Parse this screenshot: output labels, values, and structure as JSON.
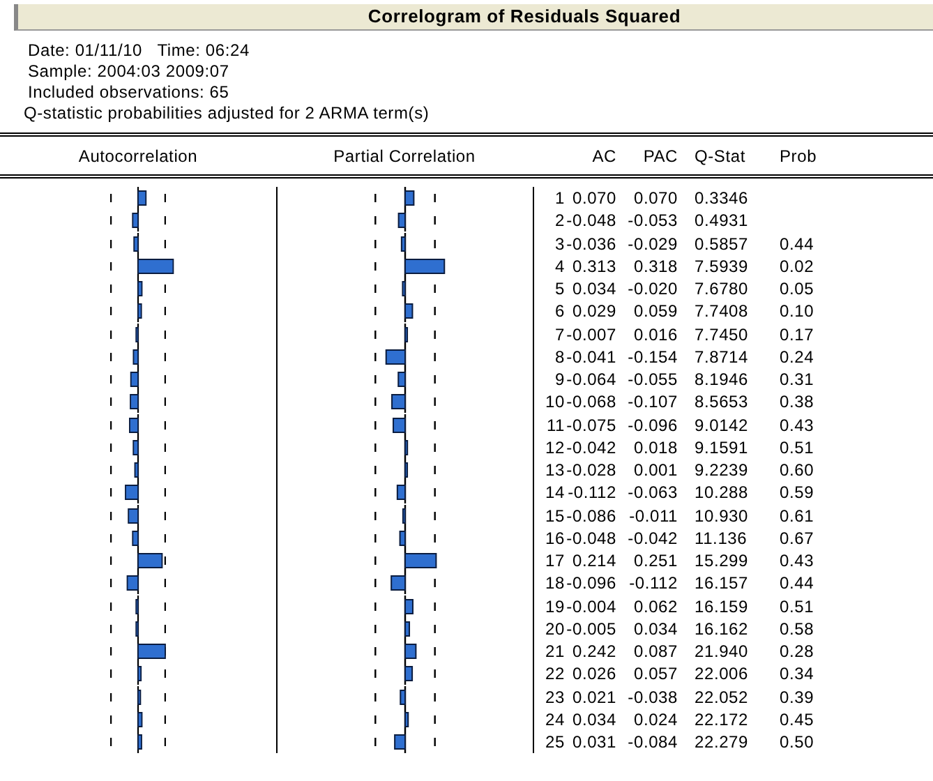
{
  "title": "Correlogram of Residuals Squared",
  "info": [
    "Date: 01/11/10   Time: 06:24",
    "Sample: 2004:03 2009:07",
    "Included observations: 65",
    "Q-statistic probabilities adjusted for 2 ARMA term(s)"
  ],
  "columns": [
    "Autocorrelation",
    "Partial Correlation",
    "AC",
    "PAC",
    "Q-Stat",
    "Prob"
  ],
  "rows": [
    {
      "lag": "1",
      "ac": "0.070",
      "pac": "0.070",
      "q": "0.3346"
    },
    {
      "lag": "2",
      "ac": "-0.048",
      "pac": "-0.053",
      "q": "0.4931"
    },
    {
      "lag": "3",
      "ac": "-0.036",
      "pac": "-0.029",
      "q": "0.5857",
      "prob": "0.44"
    },
    {
      "lag": "4",
      "ac": "0.313",
      "pac": "0.318",
      "q": "7.5939",
      "prob": "0.02"
    },
    {
      "lag": "5",
      "ac": "0.034",
      "pac": "-0.020",
      "q": "7.6780",
      "prob": "0.05"
    },
    {
      "lag": "6",
      "ac": "0.029",
      "pac": "0.059",
      "q": "7.7408",
      "prob": "0.10"
    },
    {
      "lag": "7",
      "ac": "-0.007",
      "pac": "0.016",
      "q": "7.7450",
      "prob": "0.17"
    },
    {
      "lag": "8",
      "ac": "-0.041",
      "pac": "-0.154",
      "q": "7.8714",
      "prob": "0.24"
    },
    {
      "lag": "9",
      "ac": "-0.064",
      "pac": "-0.055",
      "q": "8.1946",
      "prob": "0.31"
    },
    {
      "lag": "10",
      "ac": "-0.068",
      "pac": "-0.107",
      "q": "8.5653",
      "prob": "0.38"
    },
    {
      "lag": "11",
      "ac": "-0.075",
      "pac": "-0.096",
      "q": "9.0142",
      "prob": "0.43"
    },
    {
      "lag": "12",
      "ac": "-0.042",
      "pac": "0.018",
      "q": "9.1591",
      "prob": "0.51"
    },
    {
      "lag": "13",
      "ac": "-0.028",
      "pac": "0.001",
      "q": "9.2239",
      "prob": "0.60"
    },
    {
      "lag": "14",
      "ac": "-0.112",
      "pac": "-0.063",
      "q": "10.288",
      "prob": "0.59"
    },
    {
      "lag": "15",
      "ac": "-0.086",
      "pac": "-0.011",
      "q": "10.930",
      "prob": "0.61"
    },
    {
      "lag": "16",
      "ac": "-0.048",
      "pac": "-0.042",
      "q": "11.136",
      "prob": "0.67"
    },
    {
      "lag": "17",
      "ac": "0.214",
      "pac": "0.251",
      "q": "15.299",
      "prob": "0.43"
    },
    {
      "lag": "18",
      "ac": "-0.096",
      "pac": "-0.112",
      "q": "16.157",
      "prob": "0.44"
    },
    {
      "lag": "19",
      "ac": "-0.004",
      "pac": "0.062",
      "q": "16.159",
      "prob": "0.51"
    },
    {
      "lag": "20",
      "ac": "-0.005",
      "pac": "0.034",
      "q": "16.162",
      "prob": "0.58"
    },
    {
      "lag": "21",
      "ac": "0.242",
      "pac": "0.087",
      "q": "21.940",
      "prob": "0.28"
    },
    {
      "lag": "22",
      "ac": "0.026",
      "pac": "0.057",
      "q": "22.006",
      "prob": "0.34"
    },
    {
      "lag": "23",
      "ac": "0.021",
      "pac": "-0.038",
      "q": "22.052",
      "prob": "0.39"
    },
    {
      "lag": "24",
      "ac": "0.034",
      "pac": "0.024",
      "q": "22.172",
      "prob": "0.45"
    },
    {
      "lag": "25",
      "ac": "0.031",
      "pac": "-0.084",
      "q": "22.279",
      "prob": "0.50"
    }
  ]
}
